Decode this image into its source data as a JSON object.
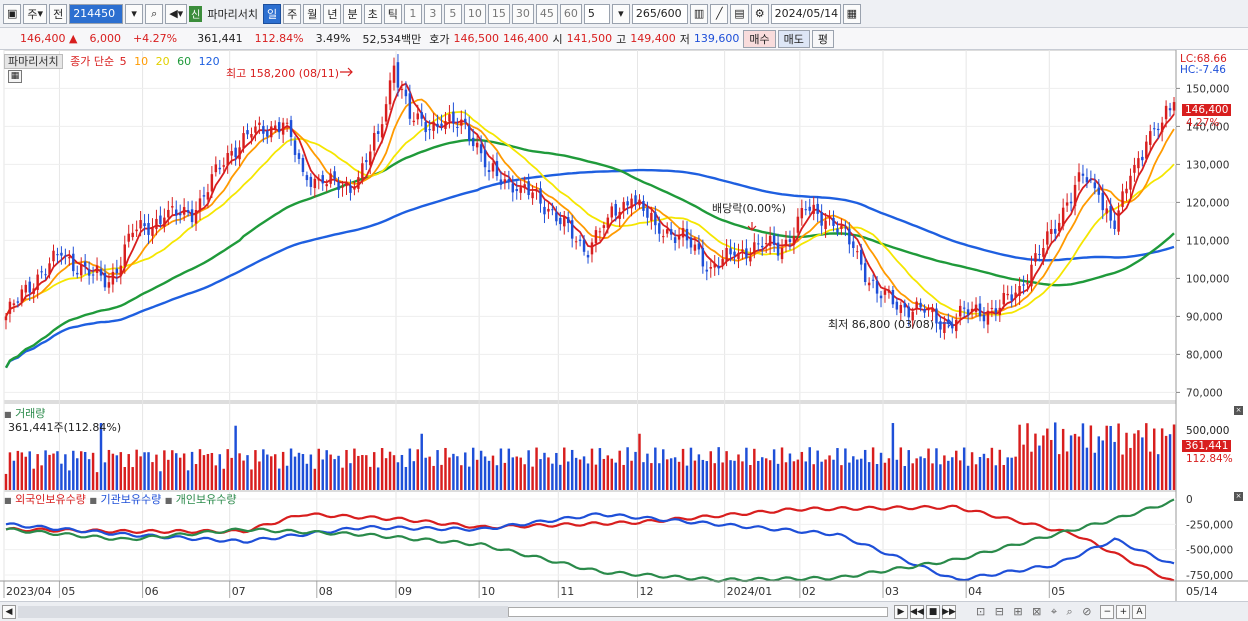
{
  "toolbar": {
    "period_label": "주",
    "prev_label": "전",
    "code": "214450",
    "sin_badge": "신",
    "stock_name": "파마리서치",
    "tf_day": "일",
    "tf_week": "주",
    "tf_month": "월",
    "tf_year": "년",
    "tf_min": "분",
    "tf_sec": "초",
    "tf_tick": "틱",
    "nums": [
      "1",
      "3",
      "5",
      "10",
      "15",
      "30",
      "45",
      "60"
    ],
    "interval": "5",
    "count": "265",
    "count_total": "/600",
    "date": "2024/05/14"
  },
  "quote": {
    "price": "146,400",
    "arrow": "▲",
    "change": "6,000",
    "rate": "+4.27%",
    "volume": "361,441",
    "vol_ratio": "112.84%",
    "turnover": "3.49%",
    "amount": "52,534백만",
    "ask_label": "호가",
    "ask1": "146,500",
    "bid1": "146,400",
    "open_label": "시",
    "open": "141,500",
    "high_label": "고",
    "high": "149,400",
    "low_label": "저",
    "low": "139,600",
    "buy_label": "매수",
    "sell_label": "매도",
    "avg_label": "평"
  },
  "main_panel": {
    "name_box": "파마리서치",
    "ma_label": "종가 단순",
    "ma_periods": [
      "5",
      "10",
      "20",
      "60",
      "120"
    ],
    "ma_colors": [
      "#d81e1e",
      "#ff9a00",
      "#f5e600",
      "#1f9a3a",
      "#1e5fe0"
    ],
    "high_annot": "최고 158,200 (08/11)",
    "low_annot": "최저 86,800 (03/08)",
    "div_annot": "배당락(0.00%)",
    "lc": "LC:68.66",
    "hc": "HC:-7.46",
    "cur_price": "146,400",
    "cur_rate": "4.27%",
    "y_ticks": [
      "150,000",
      "140,000",
      "130,000",
      "120,000",
      "110,000",
      "100,000",
      "90,000",
      "80,000",
      "70,000"
    ]
  },
  "vol_panel": {
    "title": "거래량",
    "value": "361,441주(112.84%)",
    "y_top": "500,000",
    "cur": "361,441",
    "cur_rate": "112.84%"
  },
  "hold_panel": {
    "labels": [
      "외국인보유수량",
      "기관보유수량",
      "개인보유수량"
    ],
    "colors": [
      "#d81e1e",
      "#1e4fd8",
      "#2a8a4a"
    ],
    "y_ticks": [
      "0",
      "-250,000",
      "-500,000",
      "-750,000"
    ]
  },
  "x_axis": {
    "labels": [
      "2023/04",
      "05",
      "06",
      "07",
      "08",
      "09",
      "10",
      "11",
      "12",
      "2024/01",
      "02",
      "03",
      "04",
      "05"
    ],
    "right_label": "05/14"
  },
  "chart_data": {
    "type": "candlestick",
    "x_labels": [
      "2023/04",
      "05",
      "06",
      "07",
      "08",
      "09",
      "10",
      "11",
      "12",
      "2024/01",
      "02",
      "03",
      "04",
      "05"
    ],
    "price_ylim": [
      68000,
      158000
    ],
    "anchors": [
      {
        "i": 0,
        "close": 90000
      },
      {
        "i": 8,
        "close": 101000
      },
      {
        "i": 14,
        "close": 106000
      },
      {
        "i": 22,
        "close": 101000
      },
      {
        "i": 26,
        "close": 99000
      },
      {
        "i": 32,
        "close": 112000
      },
      {
        "i": 40,
        "close": 116000
      },
      {
        "i": 48,
        "close": 118000
      },
      {
        "i": 56,
        "close": 133000
      },
      {
        "i": 62,
        "close": 138000
      },
      {
        "i": 70,
        "close": 141000
      },
      {
        "i": 75,
        "close": 128000
      },
      {
        "i": 80,
        "close": 125000
      },
      {
        "i": 88,
        "close": 124000
      },
      {
        "i": 94,
        "close": 138000
      },
      {
        "i": 98,
        "close": 156000
      },
      {
        "i": 102,
        "close": 142000
      },
      {
        "i": 110,
        "close": 140000
      },
      {
        "i": 116,
        "close": 141000
      },
      {
        "i": 122,
        "close": 128000
      },
      {
        "i": 130,
        "close": 124000
      },
      {
        "i": 138,
        "close": 118000
      },
      {
        "i": 146,
        "close": 107000
      },
      {
        "i": 152,
        "close": 116000
      },
      {
        "i": 158,
        "close": 121000
      },
      {
        "i": 164,
        "close": 114000
      },
      {
        "i": 172,
        "close": 110000
      },
      {
        "i": 178,
        "close": 103000
      },
      {
        "i": 184,
        "close": 106000
      },
      {
        "i": 190,
        "close": 109000
      },
      {
        "i": 196,
        "close": 108000
      },
      {
        "i": 202,
        "close": 118000
      },
      {
        "i": 208,
        "close": 116000
      },
      {
        "i": 214,
        "close": 108000
      },
      {
        "i": 220,
        "close": 96000
      },
      {
        "i": 226,
        "close": 93000
      },
      {
        "i": 232,
        "close": 91000
      },
      {
        "i": 238,
        "close": 88000
      },
      {
        "i": 244,
        "close": 92000
      },
      {
        "i": 250,
        "close": 91000
      },
      {
        "i": 256,
        "close": 98000
      },
      {
        "i": 262,
        "close": 108000
      },
      {
        "i": 268,
        "close": 120000
      },
      {
        "i": 272,
        "close": 127000
      },
      {
        "i": 276,
        "close": 122000
      },
      {
        "i": 280,
        "close": 113000
      },
      {
        "i": 284,
        "close": 127000
      },
      {
        "i": 288,
        "close": 136000
      },
      {
        "i": 292,
        "close": 141000
      },
      {
        "i": 295,
        "close": 146400
      }
    ],
    "hold_ylim": [
      -800000,
      20000
    ],
    "foreign_anchors": [
      [
        0,
        -300000
      ],
      [
        30,
        -320000
      ],
      [
        60,
        -320000
      ],
      [
        75,
        -150000
      ],
      [
        100,
        -200000
      ],
      [
        120,
        -280000
      ],
      [
        160,
        -230000
      ],
      [
        200,
        -100000
      ],
      [
        240,
        -80000
      ],
      [
        270,
        -350000
      ],
      [
        295,
        -820000
      ]
    ],
    "inst_anchors": [
      [
        0,
        -250000
      ],
      [
        30,
        -350000
      ],
      [
        60,
        -420000
      ],
      [
        90,
        -280000
      ],
      [
        120,
        -300000
      ],
      [
        150,
        -150000
      ],
      [
        180,
        -250000
      ],
      [
        210,
        -350000
      ],
      [
        240,
        -800000
      ],
      [
        265,
        -650000
      ],
      [
        280,
        -400000
      ],
      [
        295,
        -650000
      ]
    ],
    "indiv_anchors": [
      [
        0,
        -300000
      ],
      [
        30,
        -400000
      ],
      [
        60,
        -300000
      ],
      [
        90,
        -350000
      ],
      [
        120,
        -450000
      ],
      [
        150,
        -720000
      ],
      [
        180,
        -800000
      ],
      [
        210,
        -780000
      ],
      [
        240,
        -600000
      ],
      [
        265,
        -350000
      ],
      [
        280,
        -200000
      ],
      [
        295,
        -20000
      ]
    ]
  }
}
